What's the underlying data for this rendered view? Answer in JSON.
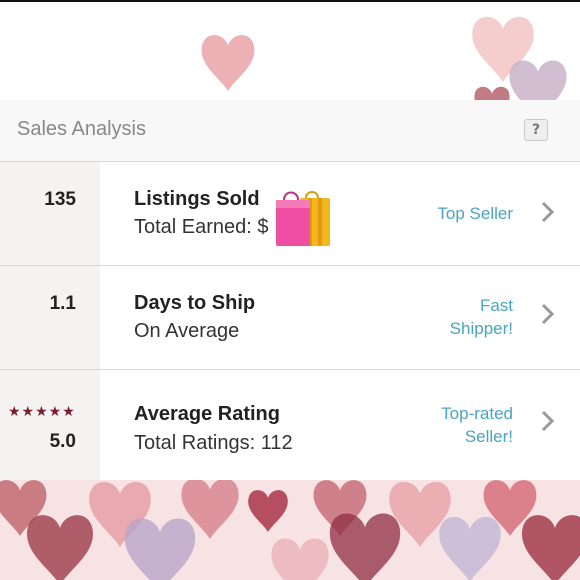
{
  "panel": {
    "title": "Sales Analysis",
    "help_label": "?"
  },
  "rows": [
    {
      "stat": "135",
      "title": "Listings Sold",
      "subtitle": "Total Earned: $",
      "badge_line1": "Top Seller",
      "badge_line2": "",
      "icon": "shopping-bags-icon"
    },
    {
      "stat": "1.1",
      "title": "Days to Ship",
      "subtitle": "On Average",
      "badge_line1": "Fast",
      "badge_line2": "Shipper!"
    },
    {
      "stat": "5.0",
      "stars": "★★★★★",
      "rating": 5.0,
      "title": "Average Rating",
      "subtitle": "Total Ratings: 112",
      "badge_line1": "Top-rated",
      "badge_line2": "Seller!"
    }
  ],
  "colors": {
    "accent": "#4aa4bf",
    "star": "#7a1e2a",
    "heart": "#c9646e"
  },
  "background": "watercolor-hearts"
}
